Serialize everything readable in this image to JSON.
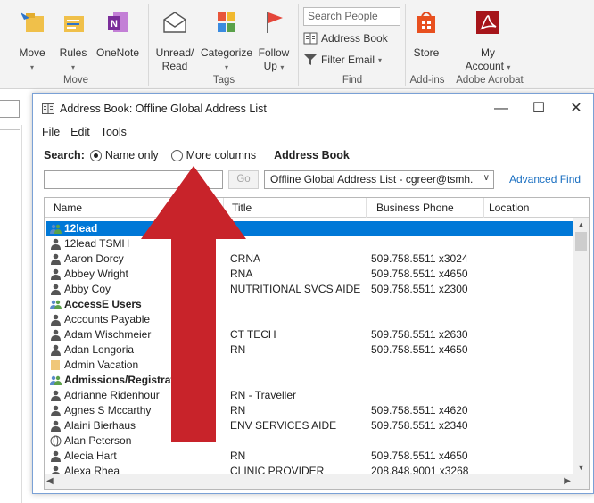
{
  "ribbon": {
    "move_group": {
      "label": "Move",
      "move": "Move",
      "rules": "Rules",
      "onenote": "OneNote"
    },
    "tags_group": {
      "label": "Tags",
      "unread_line1": "Unread/",
      "unread_line2": "Read",
      "categorize": "Categorize",
      "follow_line1": "Follow",
      "follow_line2": "Up"
    },
    "find_group": {
      "label": "Find",
      "search_people_placeholder": "Search People",
      "address_book": "Address Book",
      "filter_email": "Filter Email"
    },
    "addins_group": {
      "label": "Add-ins",
      "store": "Store"
    },
    "acrobat_group": {
      "label": "Adobe Acrobat",
      "my_line1": "My",
      "my_line2": "Account"
    }
  },
  "dialog": {
    "title": "Address Book: Offline Global Address List",
    "menu": [
      "File",
      "Edit",
      "Tools"
    ],
    "search_label": "Search:",
    "radio_name_only": "Name only",
    "radio_more_columns": "More columns",
    "address_book_label": "Address Book",
    "search_value": "",
    "go_label": "Go",
    "address_book_value": "Offline Global Address List - cgreer@tsmh.",
    "advanced_find": "Advanced Find",
    "columns": {
      "name": "Name",
      "title": "Title",
      "business_phone": "Business Phone",
      "location": "Location"
    },
    "rows": [
      {
        "name": "12lead",
        "title": "",
        "phone": "",
        "kind": "group",
        "selected": true
      },
      {
        "name": "12lead TSMH",
        "title": "",
        "phone": "",
        "kind": "person"
      },
      {
        "name": "Aaron Dorcy",
        "title": "CRNA",
        "phone": "509.758.5511 x3024",
        "kind": "person"
      },
      {
        "name": "Abbey Wright",
        "title": "RNA",
        "phone": "509.758.5511 x4650",
        "kind": "person"
      },
      {
        "name": "Abby Coy",
        "title": "NUTRITIONAL SVCS AIDE",
        "phone": "509.758.5511 x2300",
        "kind": "person"
      },
      {
        "name": "AccessE Users",
        "title": "",
        "phone": "",
        "kind": "group"
      },
      {
        "name": "Accounts Payable",
        "title": "",
        "phone": "",
        "kind": "person"
      },
      {
        "name": "Adam Wischmeier",
        "title": "CT TECH",
        "phone": "509.758.5511 x2630",
        "kind": "person"
      },
      {
        "name": "Adan Longoria",
        "title": "RN",
        "phone": "509.758.5511 x4650",
        "kind": "person"
      },
      {
        "name": "Admin Vacation",
        "title": "",
        "phone": "",
        "kind": "folder"
      },
      {
        "name": "Admissions/Registration",
        "title": "",
        "phone": "",
        "kind": "group"
      },
      {
        "name": "Adrianne Ridenhour",
        "title": "RN - Traveller",
        "phone": "",
        "kind": "person"
      },
      {
        "name": "Agnes S Mccarthy",
        "title": "RN",
        "phone": "509.758.5511 x4620",
        "kind": "person"
      },
      {
        "name": "Alaini Bierhaus",
        "title": "ENV SERVICES AIDE",
        "phone": "509.758.5511 x2340",
        "kind": "person"
      },
      {
        "name": "Alan Peterson",
        "title": "",
        "phone": "",
        "kind": "globe"
      },
      {
        "name": "Alecia Hart",
        "title": "RN",
        "phone": "509.758.5511 x4650",
        "kind": "person"
      },
      {
        "name": "Alexa Rhea",
        "title": "CLINIC PROVIDER",
        "phone": "208.848.9001 x3268",
        "kind": "person"
      }
    ]
  },
  "colors": {
    "selection": "#0078d7",
    "link": "#1a6fc1",
    "arrow": "#c8232a"
  }
}
